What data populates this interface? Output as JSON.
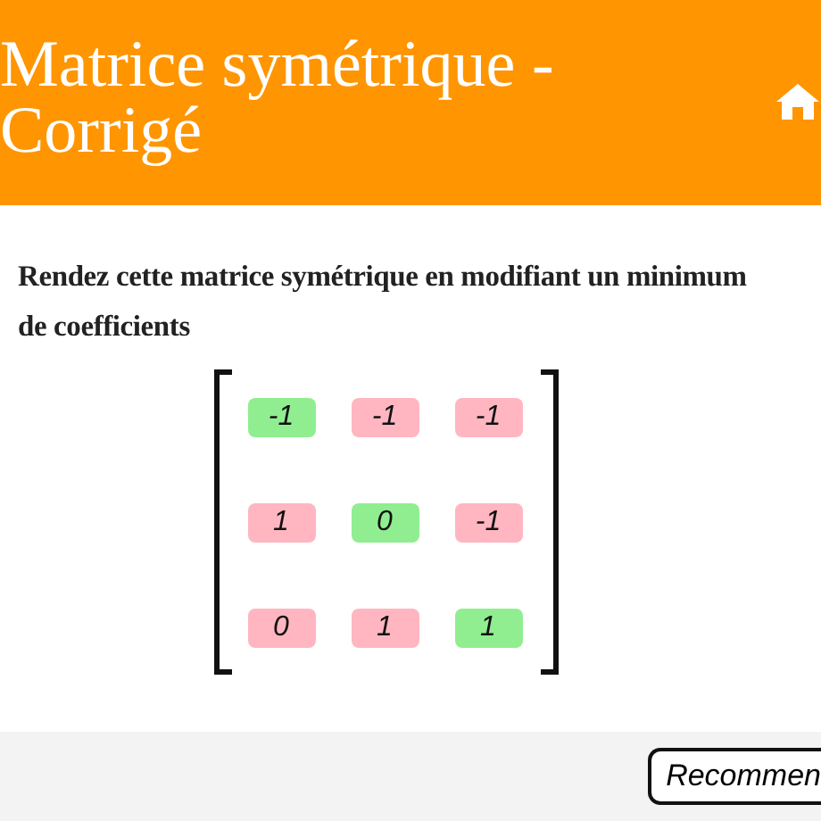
{
  "header": {
    "title_lines": [
      "Matrice symétrique -",
      "Corrigé"
    ]
  },
  "instruction": "Rendez cette matrice symétrique en modifiant un minimum de coefficients",
  "matrix": [
    [
      {
        "value": "-1",
        "color": "#90ee90"
      },
      {
        "value": "-1",
        "color": "#ffb6c1"
      },
      {
        "value": "-1",
        "color": "#ffb6c1"
      }
    ],
    [
      {
        "value": "1",
        "color": "#ffb6c1"
      },
      {
        "value": "0",
        "color": "#90ee90"
      },
      {
        "value": "-1",
        "color": "#ffb6c1"
      }
    ],
    [
      {
        "value": "0",
        "color": "#ffb6c1"
      },
      {
        "value": "1",
        "color": "#ffb6c1"
      },
      {
        "value": "1",
        "color": "#90ee90"
      }
    ]
  ],
  "footer": {
    "button": "Recommen"
  }
}
